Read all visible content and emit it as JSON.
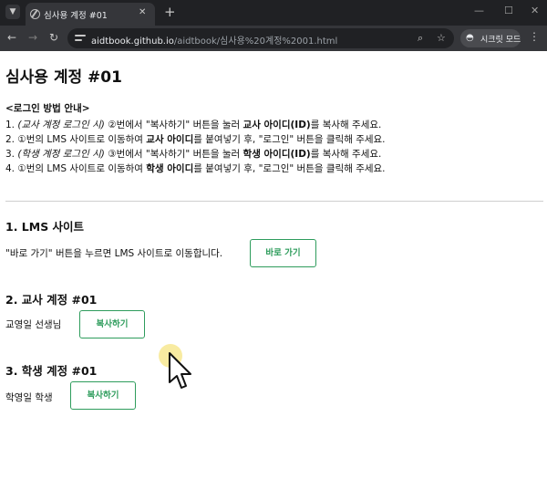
{
  "browser": {
    "tab_title": "심사용 계정 #01",
    "url_host": "aidtbook.github.io",
    "url_path": "/aidtbook/심사용%20계정%2001.html",
    "secret_mode_label": "시크릿 모드",
    "icons": [
      "tab-list-icon",
      "globe-icon",
      "close-icon",
      "new-tab-icon",
      "minimize-icon",
      "maximize-icon",
      "back-icon",
      "forward-icon",
      "reload-icon",
      "site-info-icon",
      "zoom-icon",
      "star-icon",
      "incognito-icon",
      "menu-icon"
    ]
  },
  "page": {
    "title": "심사용 계정 #01",
    "guide": {
      "heading": "<로그인 방법 안내>",
      "line1": {
        "pre": "1. ",
        "italic": "(교사 계정 로그인 시)",
        "mid": " ②번에서 \"복사하기\" 버튼을 눌러 ",
        "bold": "교사 아이디(ID)",
        "post": "를 복사해 주세요."
      },
      "line2": {
        "pre": "2. ①번의 LMS 사이트로 이동하여 ",
        "bold": "교사 아이디",
        "post": "를 붙여넣기 후, \"로그인\" 버튼을 클릭해 주세요."
      },
      "line3": {
        "pre": "3. ",
        "italic": "(학생 계정 로그인 시)",
        "mid": " ③번에서 \"복사하기\" 버튼을 눌러 ",
        "bold": "학생 아이디(ID)",
        "post": "를 복사해 주세요."
      },
      "line4": {
        "pre": "4. ①번의 LMS 사이트로 이동하여 ",
        "bold": "학생 아이디",
        "post": "를 붙여넣기 후, \"로그인\" 버튼을 클릭해 주세요."
      }
    },
    "lms": {
      "heading": "1. LMS 사이트",
      "description": "\"바로 가기\" 버튼을 누르면 LMS 사이트로 이동합니다.",
      "button": "바로 가기"
    },
    "teacher": {
      "heading": "2. 교사 계정 #01",
      "name": "교영일 선생님",
      "button": "복사하기"
    },
    "student": {
      "heading": "3. 학생 계정 #01",
      "name": "학영일 학생",
      "button": "복사하기"
    }
  },
  "colors": {
    "accent": "#2e9c5c",
    "chrome_dark": "#202124",
    "chrome_mid": "#35363a",
    "cursor_highlight": "#f6e482"
  }
}
